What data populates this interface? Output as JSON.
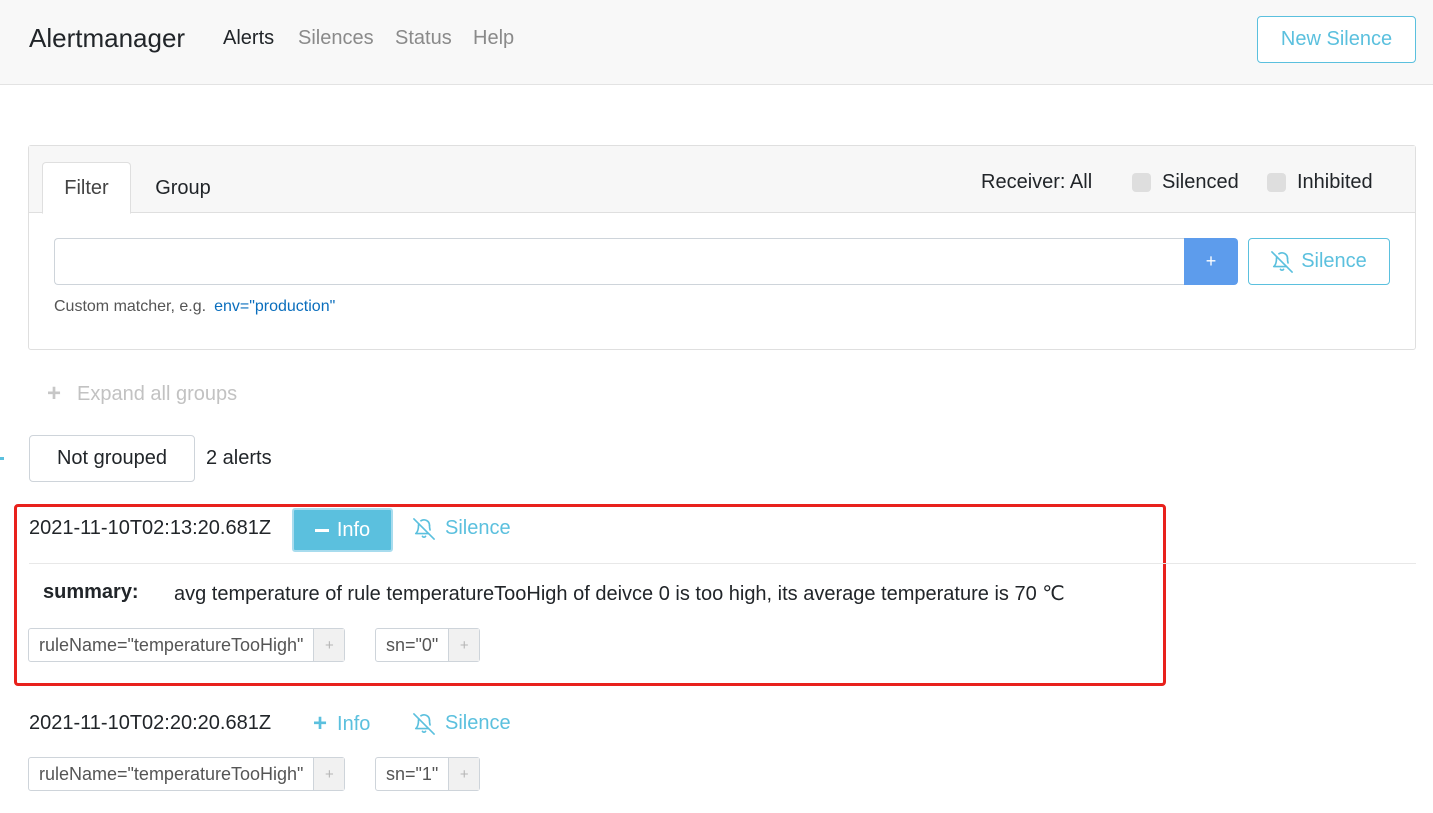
{
  "navbar": {
    "brand": "Alertmanager",
    "links": [
      "Alerts",
      "Silences",
      "Status",
      "Help"
    ],
    "active_link": "Alerts",
    "new_silence_label": "New Silence"
  },
  "filter_card": {
    "tabs": [
      "Filter",
      "Group"
    ],
    "active_tab": "Filter",
    "receiver_label": "Receiver: All",
    "silenced_label": "Silenced",
    "inhibited_label": "Inhibited",
    "input_value": "",
    "plus_label": "+",
    "silence_label": "Silence",
    "hint_text": "Custom matcher, e.g.",
    "hint_example": "env=\"production\""
  },
  "expand_all_label": "Expand all groups",
  "group": {
    "button_label": "Not grouped",
    "count_label": "2 alerts"
  },
  "alerts": [
    {
      "timestamp": "2021-11-10T02:13:20.681Z",
      "info_label": "Info",
      "info_expanded": true,
      "silence_label": "Silence",
      "annotation_key": "summary:",
      "annotation_value": "avg temperature of rule temperatureTooHigh of deivce 0 is too high, its average temperature is 70 ℃",
      "labels": [
        "ruleName=\"temperatureTooHigh\"",
        "sn=\"0\""
      ],
      "label_add": "+"
    },
    {
      "timestamp": "2021-11-10T02:20:20.681Z",
      "info_label": "Info",
      "info_expanded": false,
      "silence_label": "Silence",
      "labels": [
        "ruleName=\"temperatureTooHigh\"",
        "sn=\"1\""
      ],
      "label_add": "+"
    }
  ],
  "colors": {
    "accent": "#5bc0de",
    "primary_button": "#5d9cec",
    "highlight_border": "#e8211c",
    "link": "#0a6ebd"
  },
  "icons": {
    "silence": "bell-slash-icon",
    "expand": "plus-icon",
    "info_expanded": "minus-icon",
    "info_collapsed": "plus-icon"
  }
}
